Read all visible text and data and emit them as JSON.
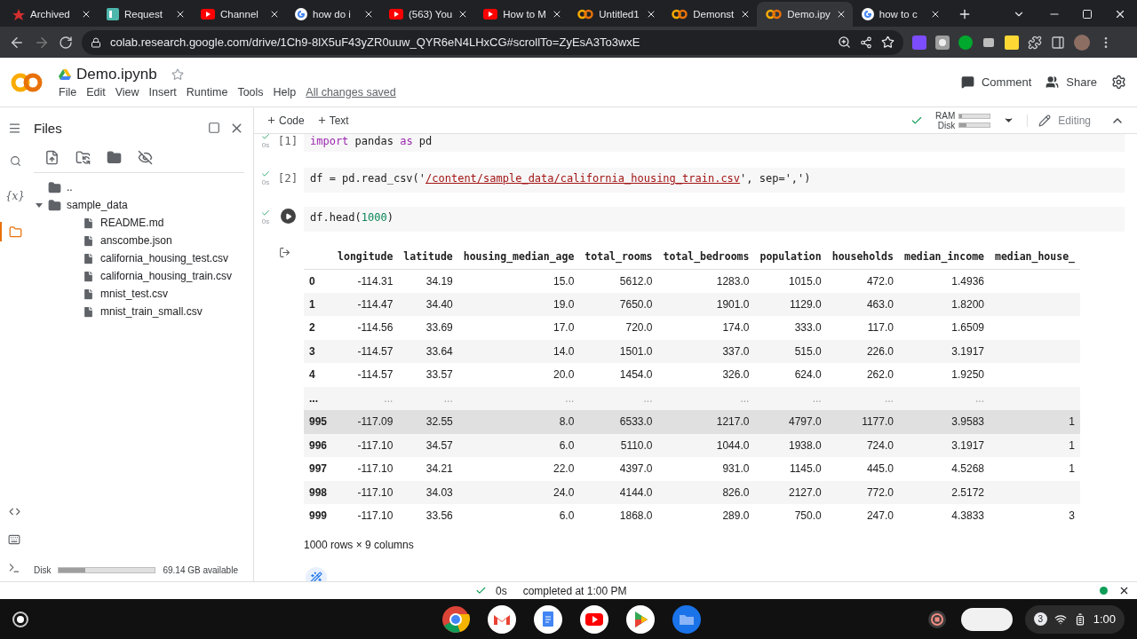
{
  "browser": {
    "tabs": [
      {
        "title": "Archived",
        "kind": "redmark",
        "selected": false
      },
      {
        "title": "Request",
        "kind": "board",
        "selected": false
      },
      {
        "title": "Channel",
        "kind": "youtube",
        "selected": false
      },
      {
        "title": "how do i",
        "kind": "google",
        "selected": false
      },
      {
        "title": "(563) You",
        "kind": "youtube",
        "selected": false
      },
      {
        "title": "How to M",
        "kind": "youtube",
        "selected": false
      },
      {
        "title": "Untitled1",
        "kind": "colab",
        "selected": false
      },
      {
        "title": "Demonst",
        "kind": "colab",
        "selected": false
      },
      {
        "title": "Demo.ipy",
        "kind": "colab",
        "selected": true
      },
      {
        "title": "how to c",
        "kind": "google",
        "selected": false
      }
    ],
    "url": "colab.research.google.com/drive/1Ch9-8lX5uF43yZR0uuw_QYR6eN4LHxCG#scrollTo=ZyEsA3To3wxE"
  },
  "notebook": {
    "title": "Demo.ipynb",
    "menu": [
      "File",
      "Edit",
      "View",
      "Insert",
      "Runtime",
      "Tools",
      "Help"
    ],
    "save_status": "All changes saved",
    "actions": [
      "Comment",
      "Share"
    ]
  },
  "toolbar": {
    "add": [
      "Code",
      "Text"
    ],
    "ram_label": "RAM",
    "disk_label": "Disk",
    "ram": {
      "level": 0.08
    },
    "disk": {
      "level": 0.22
    },
    "mode": "Editing"
  },
  "rail": {
    "variables": "{x}"
  },
  "files": {
    "title": "Files",
    "tree": [
      {
        "name": "..",
        "kind": "up"
      },
      {
        "name": "sample_data",
        "kind": "folder",
        "expanded": true,
        "children": [
          {
            "name": "README.md",
            "kind": "file"
          },
          {
            "name": "anscombe.json",
            "kind": "file"
          },
          {
            "name": "california_housing_test.csv",
            "kind": "file"
          },
          {
            "name": "california_housing_train.csv",
            "kind": "file"
          },
          {
            "name": "mnist_test.csv",
            "kind": "file"
          },
          {
            "name": "mnist_train_small.csv",
            "kind": "file"
          }
        ]
      }
    ],
    "disk_label": "Disk",
    "disk": {
      "level": 0.27
    },
    "disk_free": "69.14 GB available"
  },
  "cells": [
    {
      "count": "[1]",
      "time": "0s",
      "running": false,
      "tokens": [
        {
          "text": "import",
          "kind": "keyword"
        },
        {
          "text": " pandas ",
          "kind": "plain"
        },
        {
          "text": "as",
          "kind": "keyword"
        },
        {
          "text": " pd",
          "kind": "plain"
        }
      ]
    },
    {
      "count": "[2]",
      "time": "0s",
      "running": false,
      "tokens": [
        {
          "text": "df = pd.read_csv('",
          "kind": "plain"
        },
        {
          "text": "/content/sample_data/california_housing_train.csv",
          "kind": "path"
        },
        {
          "text": "', sep=',')",
          "kind": "plain"
        }
      ]
    },
    {
      "time": "0s",
      "running": true,
      "tokens": [
        {
          "text": "df.head(",
          "kind": "plain"
        },
        {
          "text": "1000",
          "kind": "number"
        },
        {
          "text": ")",
          "kind": "plain"
        }
      ]
    }
  ],
  "output": {
    "columns": [
      "longitude",
      "latitude",
      "housing_median_age",
      "total_rooms",
      "total_bedrooms",
      "population",
      "households",
      "median_income",
      "median_house_"
    ],
    "rows": [
      {
        "index": "0",
        "highlighted": false,
        "cells": [
          "-114.31",
          "34.19",
          "15.0",
          "5612.0",
          "1283.0",
          "1015.0",
          "472.0",
          "1.4936"
        ]
      },
      {
        "index": "1",
        "highlighted": false,
        "cells": [
          "-114.47",
          "34.40",
          "19.0",
          "7650.0",
          "1901.0",
          "1129.0",
          "463.0",
          "1.8200"
        ]
      },
      {
        "index": "2",
        "highlighted": false,
        "cells": [
          "-114.56",
          "33.69",
          "17.0",
          "720.0",
          "174.0",
          "333.0",
          "117.0",
          "1.6509"
        ]
      },
      {
        "index": "3",
        "highlighted": false,
        "cells": [
          "-114.57",
          "33.64",
          "14.0",
          "1501.0",
          "337.0",
          "515.0",
          "226.0",
          "3.1917"
        ]
      },
      {
        "index": "4",
        "highlighted": false,
        "cells": [
          "-114.57",
          "33.57",
          "20.0",
          "1454.0",
          "326.0",
          "624.0",
          "262.0",
          "1.9250"
        ]
      },
      {
        "index": "...",
        "highlighted": false,
        "cells": [
          "...",
          "...",
          "...",
          "...",
          "...",
          "...",
          "...",
          "..."
        ]
      },
      {
        "index": "995",
        "highlighted": true,
        "cells": [
          "-117.09",
          "32.55",
          "8.0",
          "6533.0",
          "1217.0",
          "4797.0",
          "1177.0",
          "3.9583",
          "1"
        ]
      },
      {
        "index": "996",
        "highlighted": false,
        "cells": [
          "-117.10",
          "34.57",
          "6.0",
          "5110.0",
          "1044.0",
          "1938.0",
          "724.0",
          "3.1917",
          "1"
        ]
      },
      {
        "index": "997",
        "highlighted": false,
        "cells": [
          "-117.10",
          "34.21",
          "22.0",
          "4397.0",
          "931.0",
          "1145.0",
          "445.0",
          "4.5268",
          "1"
        ]
      },
      {
        "index": "998",
        "highlighted": false,
        "cells": [
          "-117.10",
          "34.03",
          "24.0",
          "4144.0",
          "826.0",
          "2127.0",
          "772.0",
          "2.5172"
        ]
      },
      {
        "index": "999",
        "highlighted": false,
        "cells": [
          "-117.10",
          "33.56",
          "6.0",
          "1868.0",
          "289.0",
          "750.0",
          "247.0",
          "4.3833",
          "3"
        ]
      }
    ],
    "summary": "1000 rows × 9 columns"
  },
  "status": {
    "time": "0s",
    "message": "completed at 1:00 PM",
    "connected": true
  },
  "shelf": {
    "apps": [
      {
        "kind": "chrome"
      },
      {
        "kind": "gmail"
      },
      {
        "kind": "docs"
      },
      {
        "kind": "youtube"
      },
      {
        "kind": "play"
      },
      {
        "kind": "files"
      }
    ],
    "notifications": "3",
    "clock": "1:00"
  }
}
